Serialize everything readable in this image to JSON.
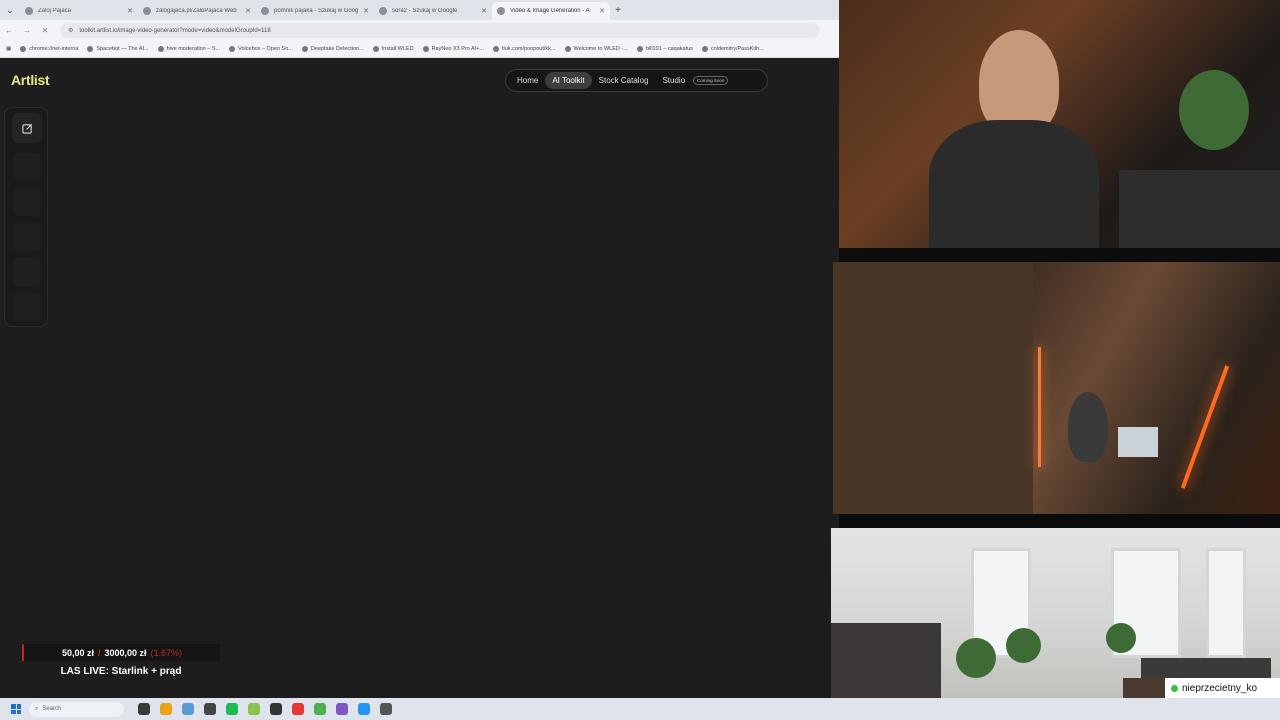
{
  "browser": {
    "tabs": [
      {
        "title": "Zaloj Pajaca",
        "active": false
      },
      {
        "title": "zalogajaca.pl/ZaloPajaca Web",
        "active": false
      },
      {
        "title": "pomnik pajaka - Szukaj w Goog",
        "active": false
      },
      {
        "title": "sora2 - Szukaj w Google",
        "active": false
      },
      {
        "title": "Video & Image Generation - A",
        "active": true
      }
    ],
    "new_tab_label": "+",
    "url": "toolkit.artlist.io/image-video-generator?mode=video&modelGroupId=118",
    "bookmarks": [
      "chrome://net-interna",
      "Spacebot — The AI...",
      "hive moderation – S...",
      "Voicebox – Open So...",
      "Deepfake Detection...",
      "Install WLED",
      "RayNeo X3 Pro AI+...",
      "tiuk.com/poopout/kk...",
      "Welcome to WLED -...",
      "bill101 – caqakatus",
      "coldemitry/PassKith..."
    ]
  },
  "artlist": {
    "logo": "Artlist",
    "nav": [
      {
        "label": "Home",
        "active": false
      },
      {
        "label": "AI Toolkit",
        "active": true
      },
      {
        "label": "Stock Catalog",
        "active": false
      },
      {
        "label": "Studio",
        "active": false
      }
    ],
    "coming_soon": "Coming Soon",
    "sidebar_icon": "edit-icon"
  },
  "overlay": {
    "donation_current": "50,00 zł",
    "donation_separator": "/",
    "donation_goal": "3000,00 zł",
    "donation_percent": "(1.67%)",
    "goal_title": "LAS LIVE: Starlink + prąd"
  },
  "taskbar": {
    "search_placeholder": "Search",
    "icon_colors": [
      "#3a3a3a",
      "#e8a317",
      "#5a9bd5",
      "#444444",
      "#1db954",
      "#8bc34a",
      "#333333",
      "#e53935",
      "#4caf50",
      "#7e57c2",
      "#2196f3",
      "#555555"
    ]
  },
  "stream": {
    "username": "nieprzecietny_ko"
  },
  "colors": {
    "logo": "#e7ea8a",
    "page_bg": "#1d1d1d",
    "accent_red": "#c0262c",
    "live_green": "#3ac13a"
  }
}
